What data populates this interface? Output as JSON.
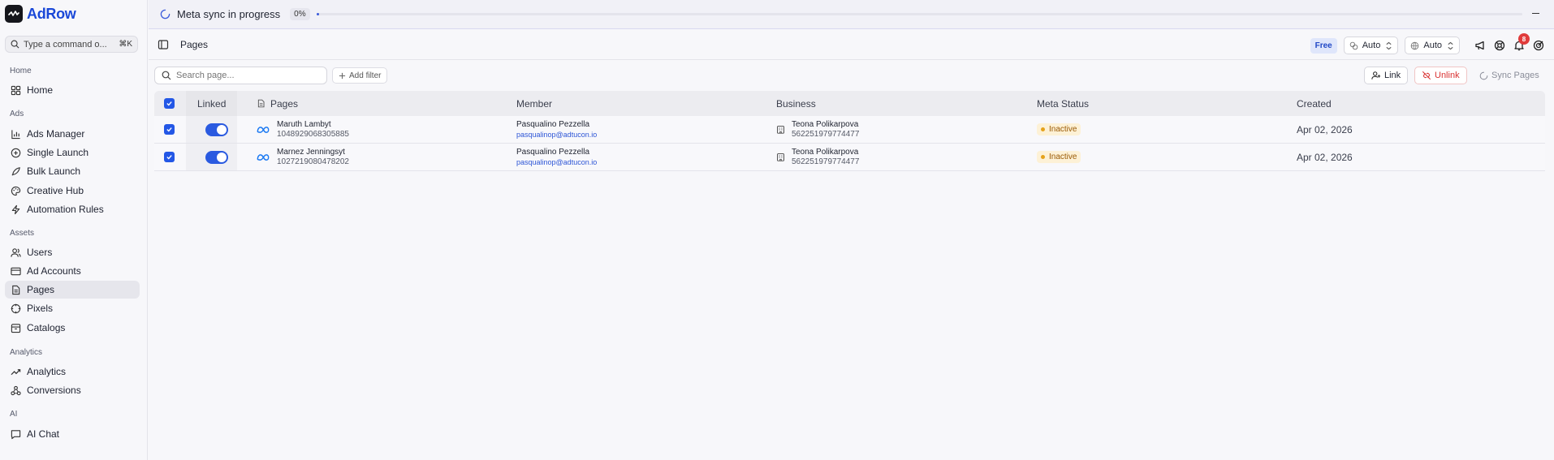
{
  "brand": {
    "name": "AdRow"
  },
  "command": {
    "placeholder": "Type a command o...",
    "shortcut": "⌘K"
  },
  "sidebar": {
    "sections": [
      {
        "title": "Home",
        "items": [
          {
            "label": "Home",
            "icon": "grid-icon"
          }
        ]
      },
      {
        "title": "Ads",
        "items": [
          {
            "label": "Ads Manager",
            "icon": "bar-chart-icon"
          },
          {
            "label": "Single Launch",
            "icon": "plus-circle-icon"
          },
          {
            "label": "Bulk Launch",
            "icon": "rocket-icon"
          },
          {
            "label": "Creative Hub",
            "icon": "palette-icon"
          },
          {
            "label": "Automation Rules",
            "icon": "zap-icon"
          }
        ]
      },
      {
        "title": "Assets",
        "items": [
          {
            "label": "Users",
            "icon": "users-icon"
          },
          {
            "label": "Ad Accounts",
            "icon": "credit-card-icon"
          },
          {
            "label": "Pages",
            "icon": "file-icon",
            "active": true
          },
          {
            "label": "Pixels",
            "icon": "crosshair-icon"
          },
          {
            "label": "Catalogs",
            "icon": "package-icon"
          }
        ]
      },
      {
        "title": "Analytics",
        "items": [
          {
            "label": "Analytics",
            "icon": "trending-up-icon"
          },
          {
            "label": "Conversions",
            "icon": "webhook-icon"
          }
        ]
      },
      {
        "title": "AI",
        "items": [
          {
            "label": "AI Chat",
            "icon": "message-icon"
          }
        ]
      }
    ]
  },
  "sync": {
    "text": "Meta sync in progress",
    "percent_label": "0%",
    "progress": 0.002
  },
  "header": {
    "title": "Pages",
    "plan_badge": "Free",
    "theme_select": "Auto",
    "language_select": "Auto",
    "notification_count": "8"
  },
  "toolbar": {
    "search_placeholder": "Search page...",
    "add_filter": "Add filter",
    "link": "Link",
    "unlink": "Unlink",
    "sync_pages": "Sync Pages"
  },
  "table": {
    "headers": {
      "linked": "Linked",
      "pages": "Pages",
      "member": "Member",
      "business": "Business",
      "meta_status": "Meta Status",
      "created": "Created"
    },
    "rows": [
      {
        "checked": true,
        "linked": true,
        "page_name": "Maruth Lambyt",
        "page_id": "1048929068305885",
        "member_name": "Pasqualino Pezzella",
        "member_email": "pasqualinop@adtucon.io",
        "business_name": "Teona Polikarpova",
        "business_id": "562251979774477",
        "status": "Inactive",
        "created": "Apr 02, 2026"
      },
      {
        "checked": true,
        "linked": true,
        "page_name": "Marnez Jenningsyt",
        "page_id": "1027219080478202",
        "member_name": "Pasqualino Pezzella",
        "member_email": "pasqualinop@adtucon.io",
        "business_name": "Teona Polikarpova",
        "business_id": "562251979774477",
        "status": "Inactive",
        "created": "Apr 02, 2026"
      }
    ]
  },
  "colors": {
    "accent": "#2357e6",
    "brand": "#1a48d8",
    "danger": "#d93333",
    "warning_bg": "#fdf1d6"
  }
}
